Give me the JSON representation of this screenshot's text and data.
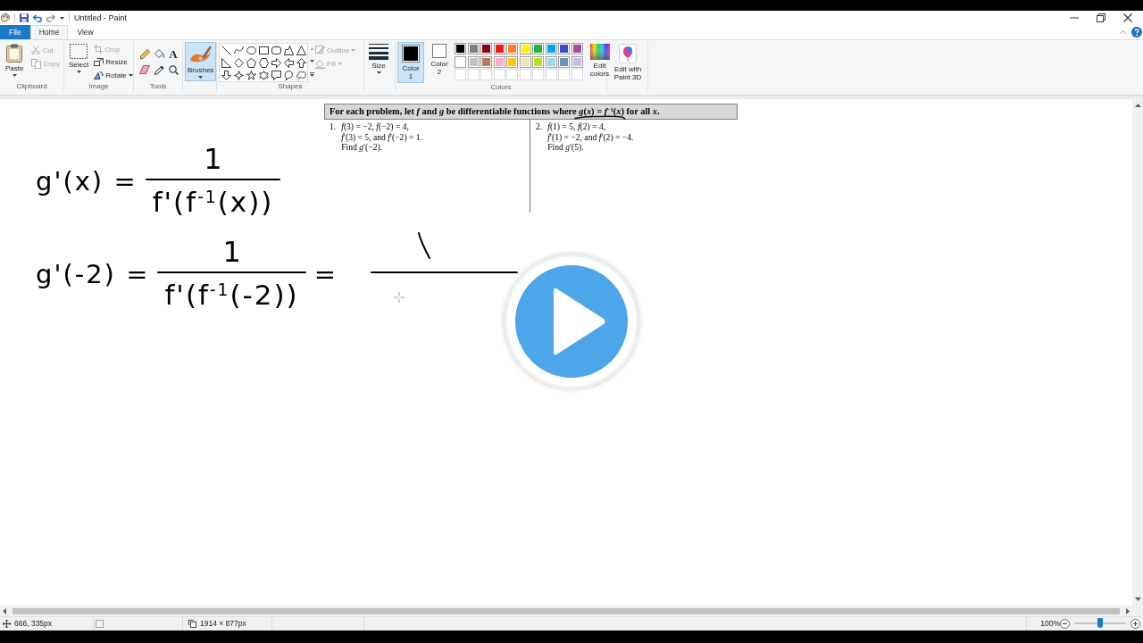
{
  "window": {
    "title": "Untitled - Paint"
  },
  "tabs": [
    {
      "label": "File",
      "kind": "file",
      "selected": false
    },
    {
      "label": "Home",
      "kind": "tab",
      "selected": true
    },
    {
      "label": "View",
      "kind": "tab",
      "selected": false
    }
  ],
  "ribbon": {
    "clipboard": {
      "label": "Clipboard",
      "paste": "Paste",
      "commands": [
        {
          "kind": "cut",
          "label": "Cut",
          "disabled": true
        },
        {
          "kind": "copy",
          "label": "Copy",
          "disabled": true
        }
      ]
    },
    "image": {
      "label": "Image",
      "select": "Select",
      "commands": [
        {
          "kind": "crop",
          "label": "Crop",
          "disabled": true,
          "dropdown": false
        },
        {
          "kind": "resize",
          "label": "Resize",
          "disabled": false,
          "dropdown": false
        },
        {
          "kind": "rotate",
          "label": "Rotate",
          "disabled": false,
          "dropdown": true
        }
      ]
    },
    "tools": {
      "label": "Tools",
      "text_tool": "A"
    },
    "brushes": {
      "label": "Brushes",
      "selected": true
    },
    "shapes": {
      "label": "Shapes",
      "options": [
        {
          "kind": "outline",
          "label": "Outline",
          "disabled": true,
          "dropdown": true
        },
        {
          "kind": "fill",
          "label": "Fill",
          "disabled": true,
          "dropdown": true
        }
      ]
    },
    "size": {
      "label": "Size"
    },
    "colors": {
      "label": "Colors",
      "slots": [
        {
          "label": "Color 1",
          "color": "#000000",
          "selected": true
        },
        {
          "label": "Color 2",
          "color": "#ffffff",
          "selected": false
        }
      ],
      "palette": [
        {
          "kind": "swatch",
          "color": "#000000"
        },
        {
          "kind": "swatch",
          "color": "#7f7f7f"
        },
        {
          "kind": "swatch",
          "color": "#880015"
        },
        {
          "kind": "swatch",
          "color": "#ed1c24"
        },
        {
          "kind": "swatch",
          "color": "#ff7f27"
        },
        {
          "kind": "swatch",
          "color": "#fff200"
        },
        {
          "kind": "swatch",
          "color": "#22b14c"
        },
        {
          "kind": "swatch",
          "color": "#00a2e8"
        },
        {
          "kind": "swatch",
          "color": "#3f48cc"
        },
        {
          "kind": "swatch",
          "color": "#a349a4"
        },
        {
          "kind": "swatch",
          "color": "#ffffff"
        },
        {
          "kind": "swatch",
          "color": "#c3c3c3"
        },
        {
          "kind": "swatch",
          "color": "#b97a57"
        },
        {
          "kind": "swatch",
          "color": "#ffaec9"
        },
        {
          "kind": "swatch",
          "color": "#ffc90e"
        },
        {
          "kind": "swatch",
          "color": "#efe4b0"
        },
        {
          "kind": "swatch",
          "color": "#b5e61d"
        },
        {
          "kind": "swatch",
          "color": "#99d9ea"
        },
        {
          "kind": "swatch",
          "color": "#7092be"
        },
        {
          "kind": "swatch",
          "color": "#c8bfe7"
        },
        {
          "kind": "empty"
        },
        {
          "kind": "empty"
        },
        {
          "kind": "empty"
        },
        {
          "kind": "empty"
        },
        {
          "kind": "empty"
        },
        {
          "kind": "empty"
        },
        {
          "kind": "empty"
        },
        {
          "kind": "empty"
        },
        {
          "kind": "empty"
        },
        {
          "kind": "empty"
        }
      ],
      "edit": "Edit colors"
    },
    "paint3d": {
      "label": "Edit with Paint 3D"
    }
  },
  "canvas": {
    "problem_sheet": {
      "header": "For each problem, let *f* and *g* be differentiable functions where *g*(*x*) = *f*$^{−1}$(*x*) for all *x*.",
      "problems": [
        {
          "number": "1.",
          "lines": [
            "*f*(3) = −2, *f*(−2) = 4,",
            "*f*′(3) = 5, and *f*′(−2) = 1.",
            "Find *g*′(−2)."
          ]
        },
        {
          "number": "2.",
          "lines": [
            "*f*(1) = 5, *f*(2) = 4,",
            "*f*′(1) = −2, and *f*′(2) = −4.",
            "Find *g*′(5)."
          ]
        }
      ]
    },
    "handwriting": [
      {
        "terms": [
          {
            "kind": "text",
            "text": "g'(x) ="
          },
          {
            "kind": "fraction",
            "numerator": "1",
            "denominator": "f'(f$^{-1}$(x))"
          }
        ]
      },
      {
        "terms": [
          {
            "kind": "text",
            "text": "g'(-2) ="
          },
          {
            "kind": "fraction",
            "numerator": "1",
            "denominator": "f'(f$^{-1}$(-2))"
          },
          {
            "kind": "text",
            "text": "="
          },
          {
            "kind": "blank_fraction"
          }
        ]
      }
    ]
  },
  "status_bar": {
    "cursor": "666, 335px",
    "canvas_size": "1914 × 877px",
    "zoom": {
      "reading": "100%",
      "level": 0.5
    }
  }
}
